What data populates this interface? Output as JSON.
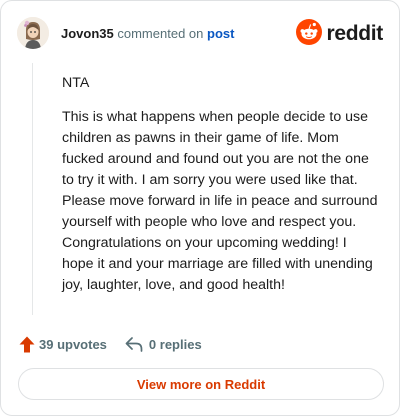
{
  "header": {
    "username": "Jovon35",
    "action_text": "commented on",
    "target_text": "post",
    "brand_name": "reddit",
    "brand_color": "#ff4500"
  },
  "avatar": {
    "icon": "avatar-icon"
  },
  "comment": {
    "paragraphs": [
      "NTA",
      "This is what happens when people decide to use children as pawns in their game of life. Mom fucked around and found out you are not the one to try it with. I am sorry you were used like that. Please move forward in life in peace and surround yourself with people who love and respect you. Congratulations on your upcoming wedding! I hope it and your marriage are filled with unending joy, laughter, love, and good health!"
    ]
  },
  "actions": {
    "upvotes": "39 upvotes",
    "replies": "0 replies",
    "upvote_icon": "upvote-arrow-icon",
    "reply_icon": "reply-arrow-icon"
  },
  "footer": {
    "view_more_label": "View more on Reddit"
  }
}
